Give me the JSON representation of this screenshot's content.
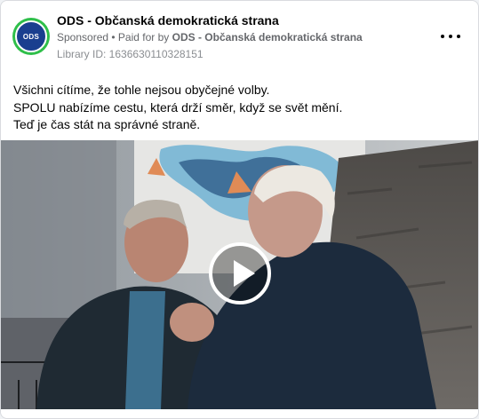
{
  "post": {
    "page_name": "ODS - Občanská demokratická strana",
    "avatar_text": "ODS",
    "sponsored_label": "Sponsored",
    "paid_for_prefix": "Paid for by",
    "paid_for_by": "ODS - Občanská demokratická strana",
    "library_id": "Library ID: 1636630110328151",
    "text_lines": [
      "Všichni cítíme, že tohle nejsou obyčejné volby.",
      "SPOLU nabízíme cestu, která drží směr, když se svět mění.",
      "Teď je čas stát na správné straně."
    ]
  },
  "icons": {
    "more": "more-horizontal-icon",
    "play": "play-icon"
  },
  "colors": {
    "avatar_ring": "#2fbf4a",
    "avatar_fill": "#1a3f8f",
    "meta_text": "#65676b"
  }
}
